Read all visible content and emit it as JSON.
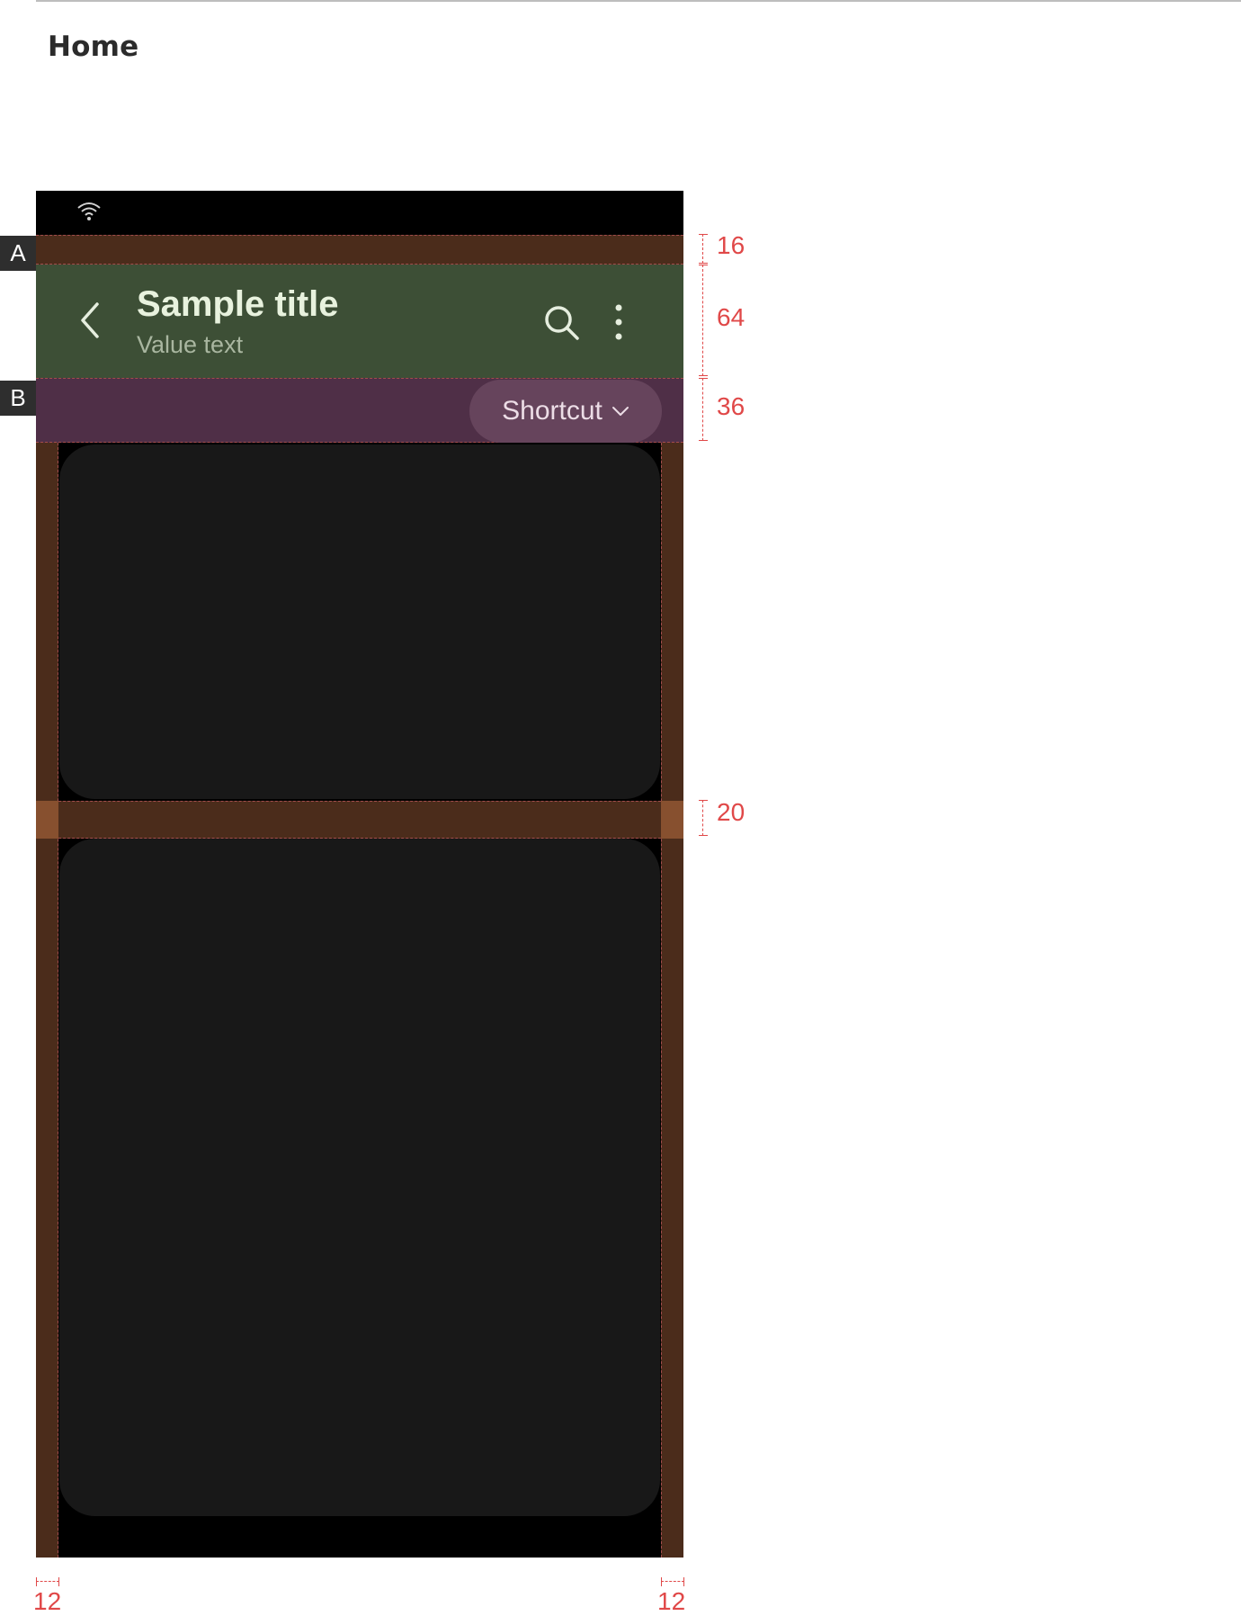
{
  "page": {
    "heading": "Home"
  },
  "app_bar": {
    "title": "Sample title",
    "subtitle": "Value text"
  },
  "shortcut": {
    "label": "Shortcut"
  },
  "icons": {
    "status": "wifi-icon",
    "back": "back-icon",
    "search": "search-icon",
    "more": "more-vertical-icon",
    "dropdown": "chevron-down-icon"
  },
  "annotations": {
    "tag_a": "A",
    "tag_b": "B",
    "spacing_top": "16",
    "app_bar_height": "64",
    "shortcut_height": "36",
    "card_gap": "20",
    "margin_left": "12",
    "margin_right": "12"
  },
  "colors": {
    "padding": "#4b2c1b",
    "app_bar": "#3d4f36",
    "shortcut_band": "#4f2f47",
    "card": "#181818",
    "annotation": "#e04848"
  }
}
